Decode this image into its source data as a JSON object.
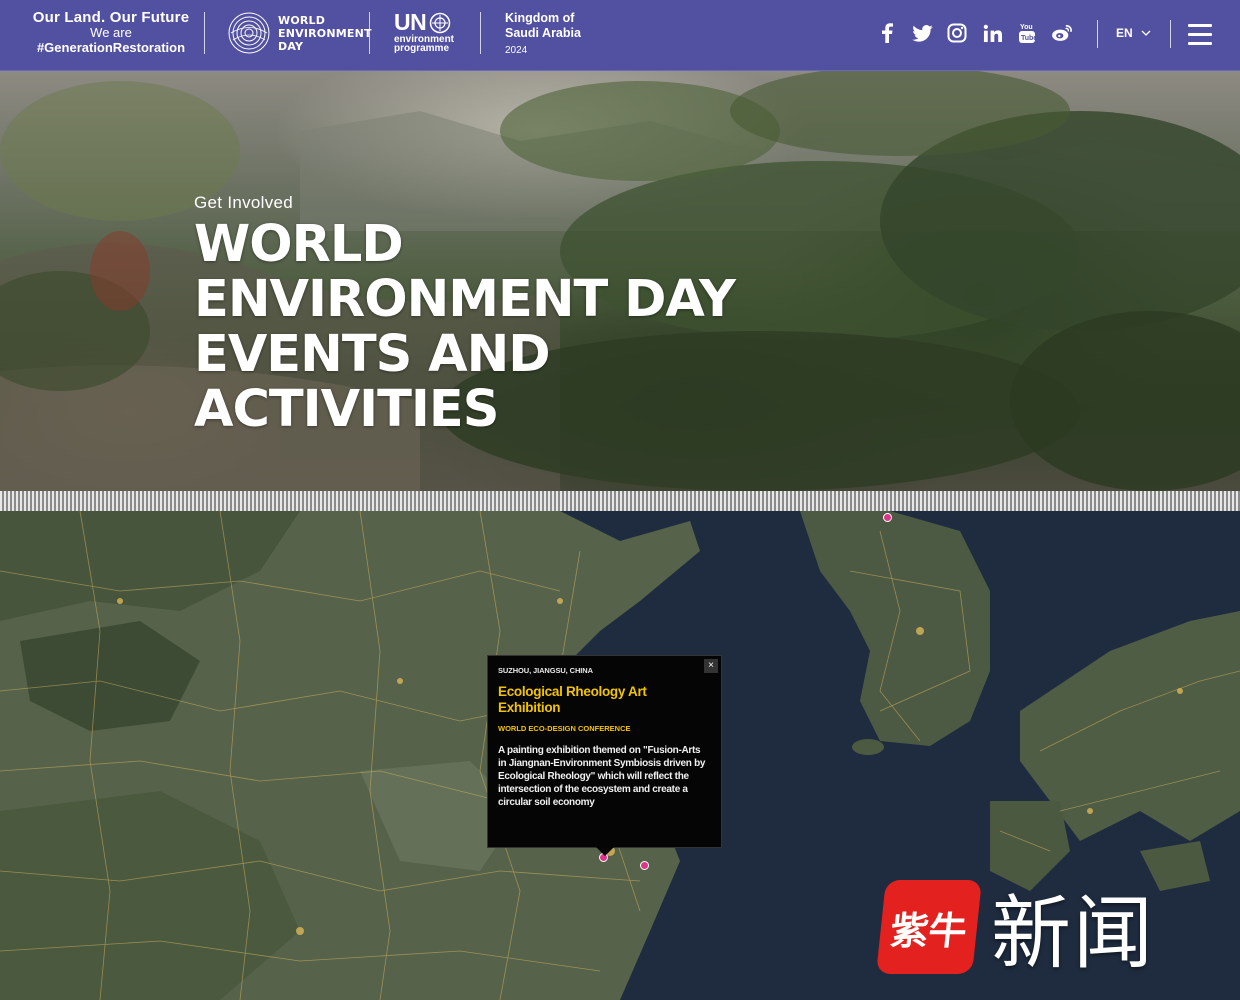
{
  "header": {
    "brand_line1": "Our Land. Our Future",
    "brand_line2": "We are",
    "brand_line3": "#GenerationRestoration",
    "wed_logo": [
      "WORLD",
      "ENVIRONMENT",
      "DAY"
    ],
    "unep_un": "UN",
    "unep_sub": [
      "environment",
      "programme"
    ],
    "host_line1": "Kingdom of",
    "host_line2": "Saudi Arabia",
    "host_year": "2024",
    "social_icons": [
      "facebook-icon",
      "twitter-icon",
      "instagram-icon",
      "linkedin-icon",
      "youtube-icon",
      "weibo-icon"
    ],
    "language": "EN",
    "background_color": "#5250a0"
  },
  "hero": {
    "eyebrow": "Get Involved",
    "title": "WORLD ENVIRONMENT DAY EVENTS AND ACTIVITIES"
  },
  "map": {
    "marker_color": "#e0338a",
    "popup": {
      "location": "SUZHOU, JIANGSU, CHINA",
      "title": "Ecological Rheology Art Exhibition",
      "organizer": "WORLD ECO-DESIGN CONFERENCE",
      "description": "A painting exhibition themed on \"Fusion-Arts in Jiangnan-Environment Symbiosis driven by Ecological Rheology\" which will reflect the intersection of the ecosystem and create a circular soil economy",
      "close_label": "×",
      "title_color": "#f2c400"
    }
  },
  "watermark": {
    "badge_text": "紫牛",
    "text": "新闻"
  }
}
